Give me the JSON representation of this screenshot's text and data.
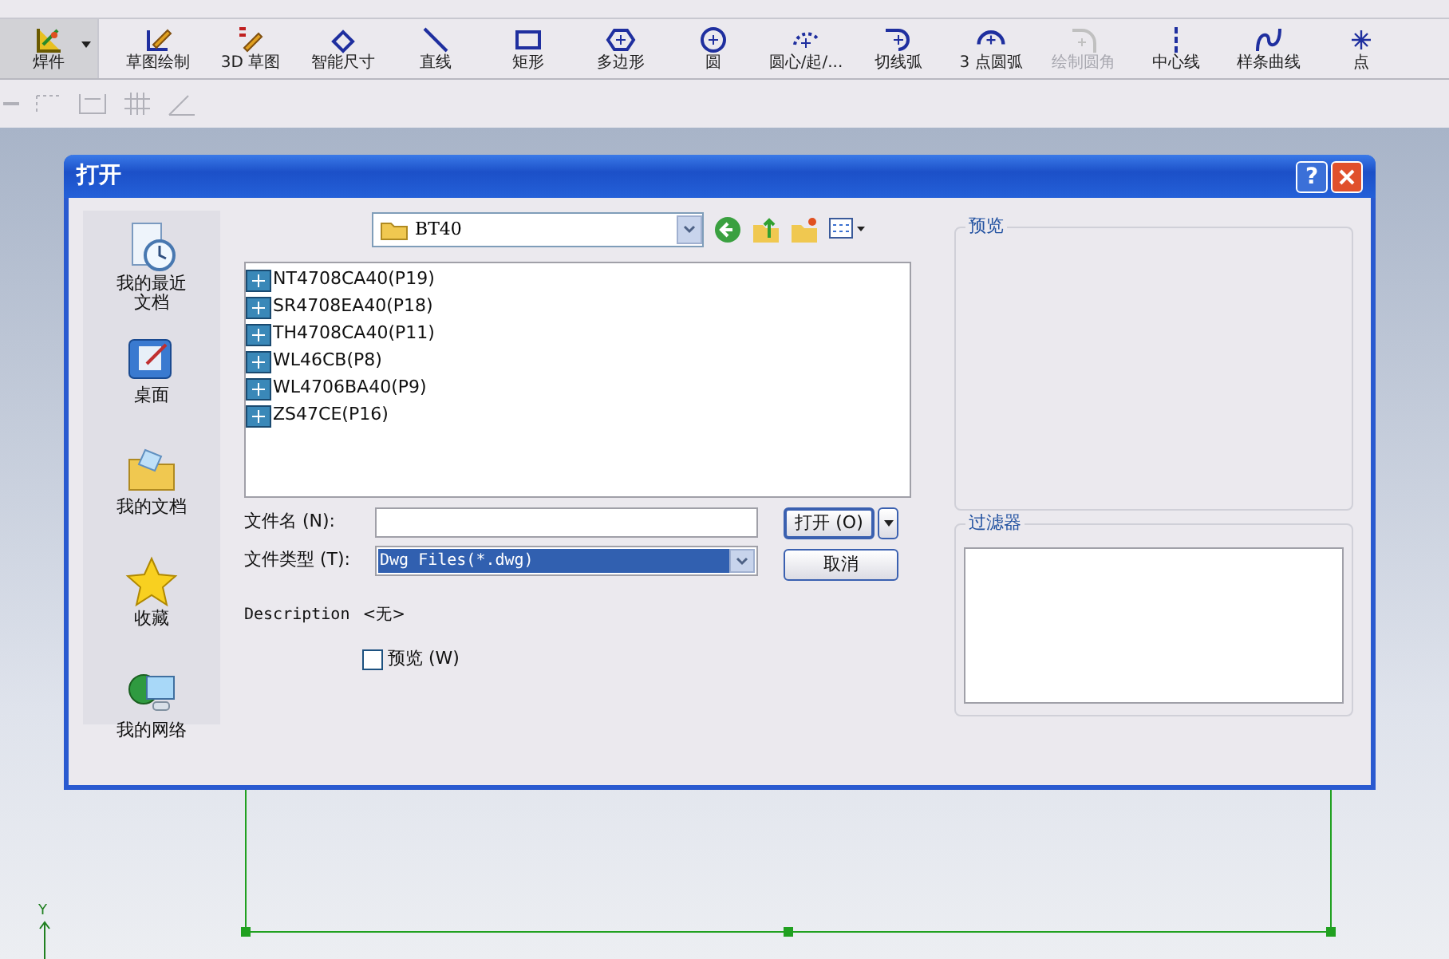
{
  "toolbar": {
    "items": [
      {
        "label": "焊件",
        "kind": "dropdown",
        "selected": true,
        "disabled": false
      },
      {
        "label": "草图绘制",
        "kind": "sketch",
        "selected": false,
        "disabled": false
      },
      {
        "label": "3D 草图",
        "kind": "sketch3d",
        "selected": false,
        "disabled": false
      },
      {
        "label": "智能尺寸",
        "kind": "dimension",
        "selected": false,
        "disabled": false
      },
      {
        "label": "直线",
        "kind": "line",
        "selected": false,
        "disabled": false
      },
      {
        "label": "矩形",
        "kind": "rect",
        "selected": false,
        "disabled": false
      },
      {
        "label": "多边形",
        "kind": "polygon",
        "selected": false,
        "disabled": false
      },
      {
        "label": "圆",
        "kind": "circle",
        "selected": false,
        "disabled": false
      },
      {
        "label": "圆心/起/...",
        "kind": "centerarc",
        "selected": false,
        "disabled": false
      },
      {
        "label": "切线弧",
        "kind": "tangentarc",
        "selected": false,
        "disabled": false
      },
      {
        "label": "3 点圆弧",
        "kind": "arc3",
        "selected": false,
        "disabled": false
      },
      {
        "label": "绘制圆角",
        "kind": "fillet",
        "selected": false,
        "disabled": true
      },
      {
        "label": "中心线",
        "kind": "centerline",
        "selected": false,
        "disabled": false
      },
      {
        "label": "样条曲线",
        "kind": "spline",
        "selected": false,
        "disabled": false
      },
      {
        "label": "点",
        "kind": "point",
        "selected": false,
        "disabled": false
      }
    ]
  },
  "canvas": {
    "axis_label": "Y"
  },
  "dialog": {
    "title": "打开",
    "help_button": "?",
    "places": [
      {
        "label": "我的最近文档",
        "kind": "recent"
      },
      {
        "label": "桌面",
        "kind": "desktop"
      },
      {
        "label": "我的文档",
        "kind": "documents"
      },
      {
        "label": "收藏",
        "kind": "favorites"
      },
      {
        "label": "我的网络",
        "kind": "network"
      }
    ],
    "folder": "BT40",
    "files": [
      "NT4708CA40(P19)",
      "SR4708EA40(P18)",
      "TH4708CA40(P11)",
      "WL46CB(P8)",
      "WL4706BA40(P9)",
      "ZS47CE(P16)"
    ],
    "file_name_label": "文件名 (N):",
    "file_type_label": "文件类型 (T):",
    "file_type": "Dwg Files(*.dwg)",
    "open_button": "打开 (O)",
    "cancel_button": "取消",
    "description_label": "Description",
    "description": "<无>",
    "preview_checkbox": {
      "label": "预览 (W)",
      "checked": false
    },
    "preview_group": "预览",
    "filter_group": "过滤器"
  }
}
